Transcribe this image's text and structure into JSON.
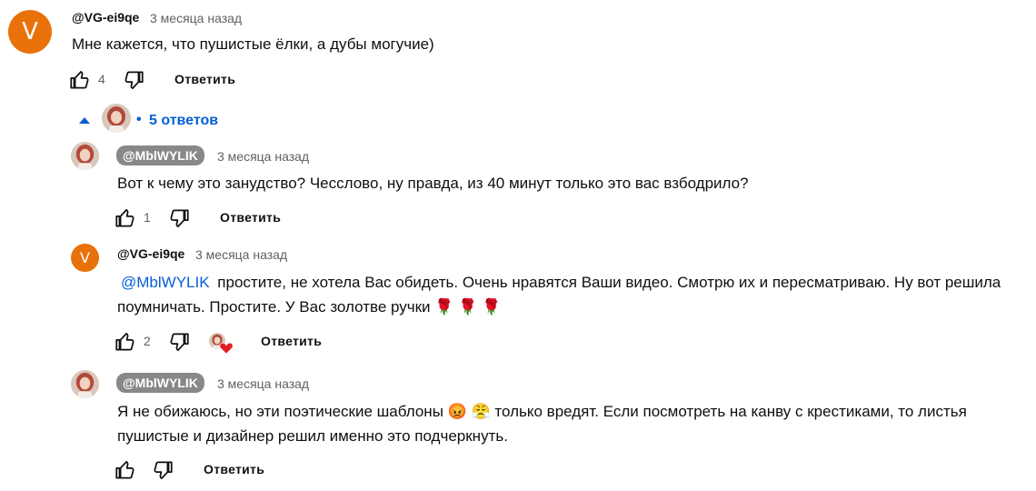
{
  "comment": {
    "avatar_letter": "V",
    "author": "@VG-ei9qe",
    "time": "3 месяца назад",
    "text": "Мне кажется, что пушистые ёлки, а дубы могучие)",
    "likes": "4",
    "reply_label": "Ответить"
  },
  "replies_toggle": {
    "bullet": "•",
    "label": "5 ответов"
  },
  "replies": [
    {
      "author": "@MblWYLIK",
      "time": "3 месяца назад",
      "text": "Вот к чему это занудство? Чесслово, ну правда, из 40 минут только это вас взбодрило?",
      "likes": "1",
      "reply_label": "Ответить"
    },
    {
      "avatar_letter": "V",
      "author": "@VG-ei9qe",
      "time": "3 месяца назад",
      "mention": "@MblWYLIK",
      "text_line1": "простите, не хотела Вас обидеть. Очень нравятся Ваши видео. Смотрю их и пересматриваю. Ну вот решила",
      "text_line2": "поумничать. Простите. У Вас золотве ручки 🌹 🌹 🌹",
      "likes": "2",
      "reply_label": "Ответить"
    },
    {
      "author": "@MblWYLIK",
      "time": "3 месяца назад",
      "text_line1": "Я не обижаюсь, но эти поэтические шаблоны 😡 😤 только вредят. Если посмотреть на канву с крестиками, то листья",
      "text_line2": "пушистые и дизайнер решил именно это подчеркнуть.",
      "reply_label": "Ответить"
    }
  ],
  "colors": {
    "avatar_orange": "#e8710a",
    "link_blue": "#065fd4",
    "chip_gray": "#888888",
    "heart_red": "#e41b23"
  }
}
